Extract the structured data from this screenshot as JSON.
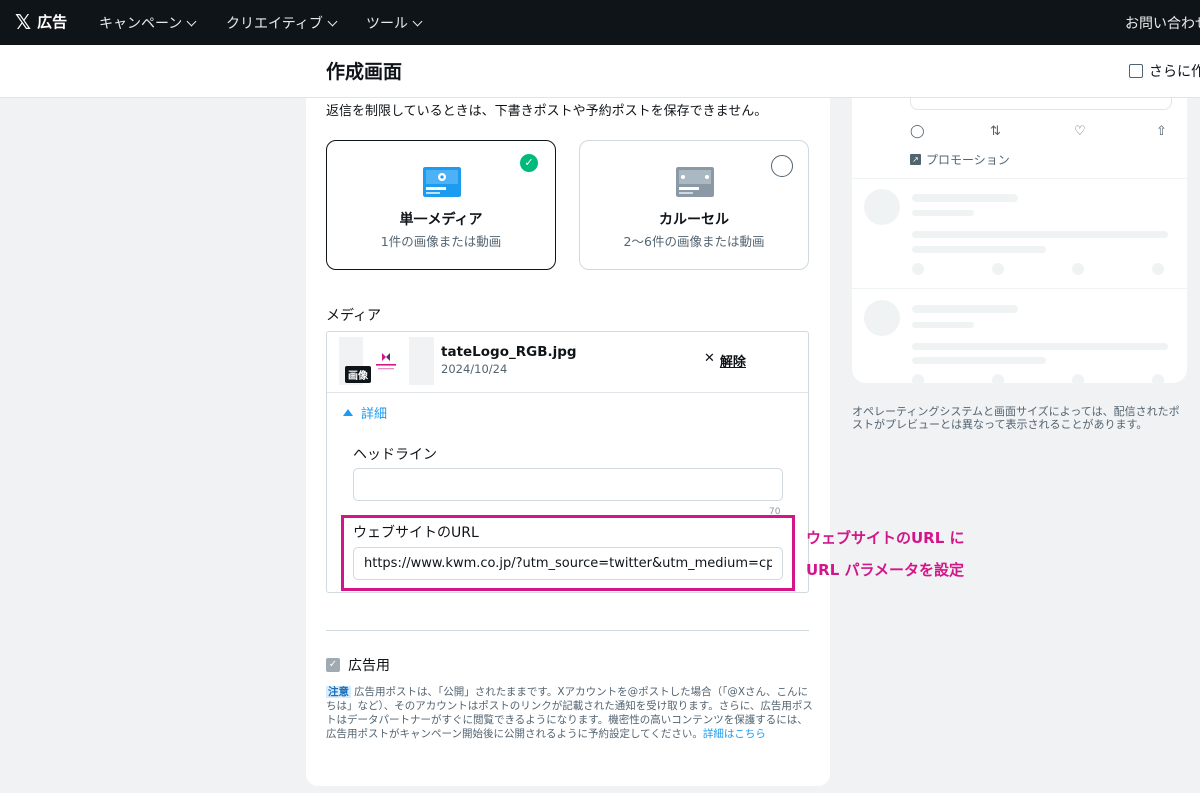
{
  "nav": {
    "logo_text": "広告",
    "items": [
      {
        "label": "キャンペーン"
      },
      {
        "label": "クリエイティブ"
      },
      {
        "label": "ツール"
      }
    ],
    "contact": "お問い合わせ"
  },
  "header": {
    "title": "作成画面",
    "more_create_label": "さらに作成"
  },
  "form": {
    "restrict_notice": "返信を制限しているときは、下書きポストや予約ポストを保存できません。",
    "media_types": [
      {
        "title": "単一メディア",
        "subtitle": "1件の画像または動画",
        "selected": true
      },
      {
        "title": "カルーセル",
        "subtitle": "2〜6件の画像または動画",
        "selected": false
      }
    ],
    "media_label": "メディア",
    "media_file": {
      "badge": "画像",
      "name": "tateLogo_RGB.jpg",
      "date": "2024/10/24",
      "remove_label": "解除"
    },
    "details_label": "詳細",
    "headline_label": "ヘッドライン",
    "headline_value": "",
    "headline_counter": "70",
    "website_url_label": "ウェブサイトのURL",
    "website_url_value": "https://www.kwm.co.jp/?utm_source=twitter&utm_medium=cpc",
    "ad_use_label": "広告用",
    "ad_use_checked": true,
    "note_tag": "注意",
    "note_text": "広告用ポストは、「公開」されたままです。Xアカウントを@ポストした場合（「@Xさん、こんにちは」など）、そのアカウントはポストのリンクが記載された通知を受け取ります。さらに、広告用ポストはデータパートナーがすぐに閲覧できるようになります。機密性の高いコンテンツを保護するには、広告用ポストがキャンペーン開始後に公開されるように予約設定してください。",
    "note_link": "詳細はこちら"
  },
  "annotation": {
    "line1": "ウェブサイトのURL に",
    "line2": "URL パラメータを設定",
    "color": "#d4158a"
  },
  "preview": {
    "promo_label": "プロモーション",
    "note": "オペレーティングシステムと画面サイズによっては、配信されたポストがプレビューとは異なって表示されることがあります。"
  },
  "colors": {
    "accent": "#1d9bf0",
    "success": "#00ba7c",
    "nav_bg": "#0f1419"
  }
}
